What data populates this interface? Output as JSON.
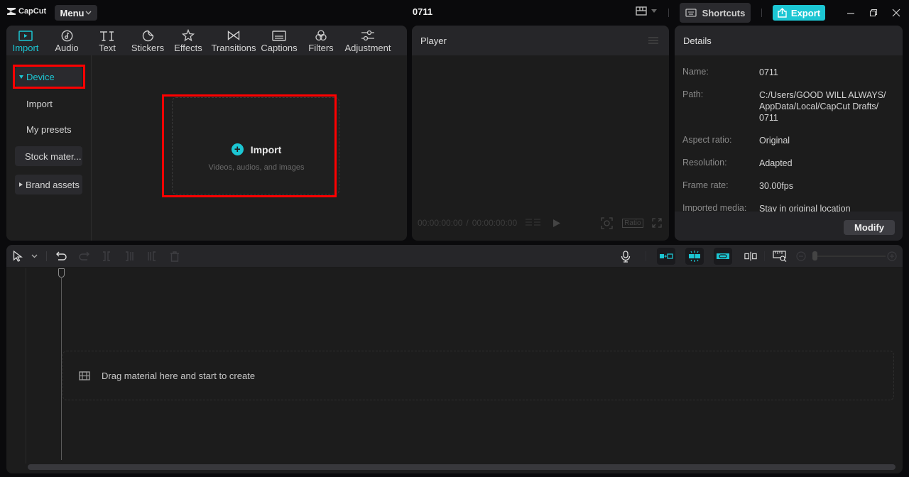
{
  "app": {
    "logo_text": "CapCut",
    "menu_label": "Menu",
    "document_title": "0711",
    "shortcuts_label": "Shortcuts",
    "export_label": "Export",
    "accent_color": "#1cc6d3"
  },
  "media": {
    "tabs": [
      {
        "label": "Import",
        "icon": "import-icon",
        "active": true
      },
      {
        "label": "Audio",
        "icon": "audio-icon"
      },
      {
        "label": "Text",
        "icon": "text-icon"
      },
      {
        "label": "Stickers",
        "icon": "stickers-icon"
      },
      {
        "label": "Effects",
        "icon": "effects-icon"
      },
      {
        "label": "Transitions",
        "icon": "transitions-icon"
      },
      {
        "label": "Captions",
        "icon": "captions-icon"
      },
      {
        "label": "Filters",
        "icon": "filters-icon"
      },
      {
        "label": "Adjustment",
        "icon": "adjustment-icon"
      }
    ],
    "sidebar": {
      "device": "Device",
      "import": "Import",
      "my_presets": "My presets",
      "stock_material": "Stock mater...",
      "brand_assets": "Brand assets"
    },
    "import_area": {
      "title": "Import",
      "subtitle": "Videos, audios, and images"
    }
  },
  "player": {
    "title": "Player",
    "current_time": "00:00:00:00",
    "separator": "/",
    "total_time": "00:00:00:00",
    "ratio_label": "Ratio"
  },
  "details": {
    "title": "Details",
    "rows": [
      {
        "label": "Name:",
        "value": "0711"
      },
      {
        "label": "Path:",
        "value": "C:/Users/GOOD WILL ALWAYS/ AppData/Local/CapCut Drafts/ 0711"
      },
      {
        "label": "Aspect ratio:",
        "value": "Original"
      },
      {
        "label": "Resolution:",
        "value": "Adapted"
      },
      {
        "label": "Frame rate:",
        "value": "30.00fps"
      },
      {
        "label": "Imported media:",
        "value": "Stay in original location"
      }
    ],
    "modify_label": "Modify"
  },
  "timeline": {
    "drop_hint": "Drag material here and start to create"
  }
}
